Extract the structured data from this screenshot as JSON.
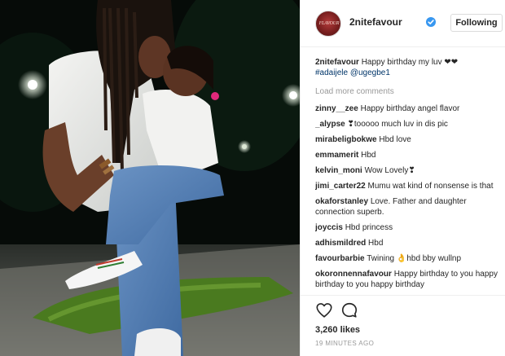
{
  "post": {
    "author": "2nitefavour",
    "avatar_text": "FLAVOUR",
    "verified_icon": "verified-badge-icon",
    "follow_label": "Following",
    "caption": {
      "username": "2nitefavour",
      "text": "Happy birthday my luv ❤❤",
      "tags": "#adaijele @ugegbe1"
    },
    "load_more": "Load more comments",
    "comments": [
      {
        "username": "zinny__zee",
        "text": "Happy birthday angel flavor"
      },
      {
        "username": "_alypse",
        "text": "❣tooooo much luv in dis pic"
      },
      {
        "username": "mirabeligbokwe",
        "text": "Hbd love"
      },
      {
        "username": "emmamerit",
        "text": "Hbd"
      },
      {
        "username": "kelvin_moni",
        "text": "Wow Lovely❣"
      },
      {
        "username": "jimi_carter22",
        "text": "Mumu wat kind of nonsense is that"
      },
      {
        "username": "okaforstanley",
        "text": "Love. Father and daughter connection superb."
      },
      {
        "username": "joyccis",
        "text": "Hbd princess"
      },
      {
        "username": "adhismildred",
        "text": "Hbd"
      },
      {
        "username": "favourbarbie",
        "text": "Twining 👌hbd bby wullnp"
      },
      {
        "username": "okoronnennafavour",
        "text": "Happy birthday to you happy birthday to you happy birthday"
      }
    ],
    "like_icon": "heart-outline-icon",
    "comment_icon": "comment-bubble-icon",
    "likes": "3,260 likes",
    "timestamp": "19 MINUTES AGO"
  },
  "colors": {
    "link": "#003569",
    "verified": "#3897f0",
    "muted": "#999999",
    "border": "#efefef"
  }
}
